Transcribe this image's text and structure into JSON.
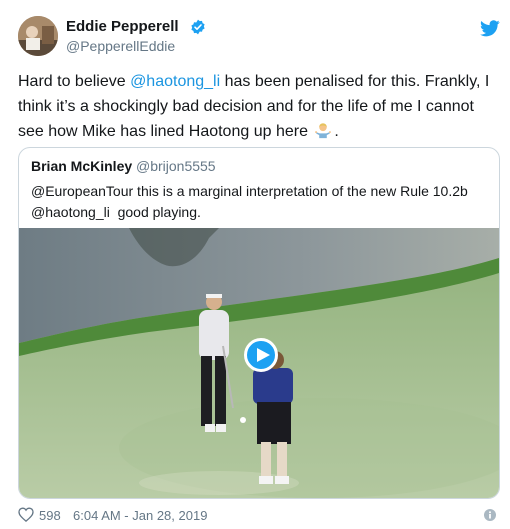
{
  "author": {
    "display_name": "Eddie Pepperell",
    "handle": "@PepperellEddie",
    "verified": true
  },
  "tweet": {
    "text_1": "Hard to believe ",
    "mention": "@haotong_li",
    "text_2": " has been penalised for this. Frankly, I think it’s a shockingly bad decision and for the life of me I cannot see how Mike has lined Haotong up here ",
    "emoji": "man-shrugging",
    "text_3": "."
  },
  "quoted_tweet": {
    "display_name": "Brian McKinley",
    "handle": "@brijon5555",
    "line_1_mention": "@EuropeanTour",
    "line_1_text": " this is a marginal interpretation of the new Rule 10.2b",
    "line_2_mention": "@haotong_li",
    "line_2_text": "  good playing."
  },
  "video": {
    "play_icon": "play-icon"
  },
  "footer": {
    "likes": "598",
    "timestamp": "6:04 AM - Jan 28, 2019"
  },
  "icons": {
    "verified": "verified-badge-icon",
    "brand": "twitter-bird-icon",
    "like": "heart-icon",
    "info": "info-icon"
  },
  "colors": {
    "link": "#1b95e0",
    "brand": "#1da1f2",
    "secondary_text": "#657786",
    "text": "#14171a"
  }
}
